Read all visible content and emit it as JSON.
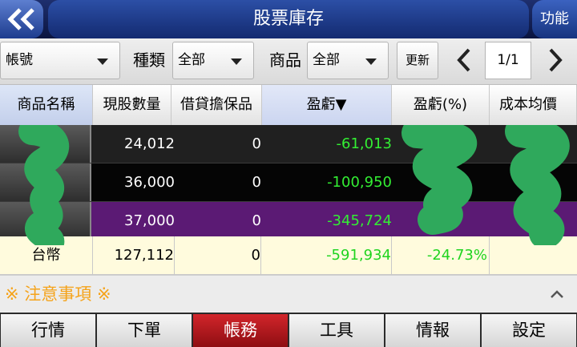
{
  "header": {
    "back_icon": "double-chevron-left-icon",
    "title": "股票庫存",
    "function_label": "功能"
  },
  "filters": {
    "account_value": "帳號",
    "type_label": "種類",
    "type_value": "全部",
    "product_label": "商品",
    "product_value": "全部",
    "refresh_label": "更新",
    "page_indicator": "1/1"
  },
  "table": {
    "columns": [
      "商品名稱",
      "現股數量",
      "借貸擔保品",
      "盈虧▼",
      "盈虧(%)",
      "成本均價"
    ],
    "rows": [
      {
        "name": "",
        "qty": "24,012",
        "collateral": "0",
        "pnl": "-61,013",
        "pnl_pct": "",
        "avg_cost": ""
      },
      {
        "name": "",
        "qty": "36,000",
        "collateral": "0",
        "pnl": "-100,950",
        "pnl_pct": "",
        "avg_cost": ""
      },
      {
        "name": "",
        "qty": "37,000",
        "collateral": "0",
        "pnl": "-345,724",
        "pnl_pct": "",
        "avg_cost": ""
      },
      {
        "name": "台幣",
        "qty": "127,112",
        "collateral": "0",
        "pnl": "-591,934",
        "pnl_pct": "-24.73%",
        "avg_cost": ""
      }
    ]
  },
  "notice": {
    "label": "※ 注意事項 ※",
    "toggle_icon": "chevron-up-icon"
  },
  "bottom_nav": {
    "tabs": [
      "行情",
      "下單",
      "帳務",
      "工具",
      "情報",
      "設定"
    ],
    "active": "帳務"
  },
  "colors": {
    "header_blue": "#1e3c8c",
    "loss_green": "#33ee33",
    "accent_orange": "#f5a31a",
    "active_tab_red": "#c41e24",
    "row_purple": "#5b1a74",
    "summary_row": "#fffbdd"
  }
}
